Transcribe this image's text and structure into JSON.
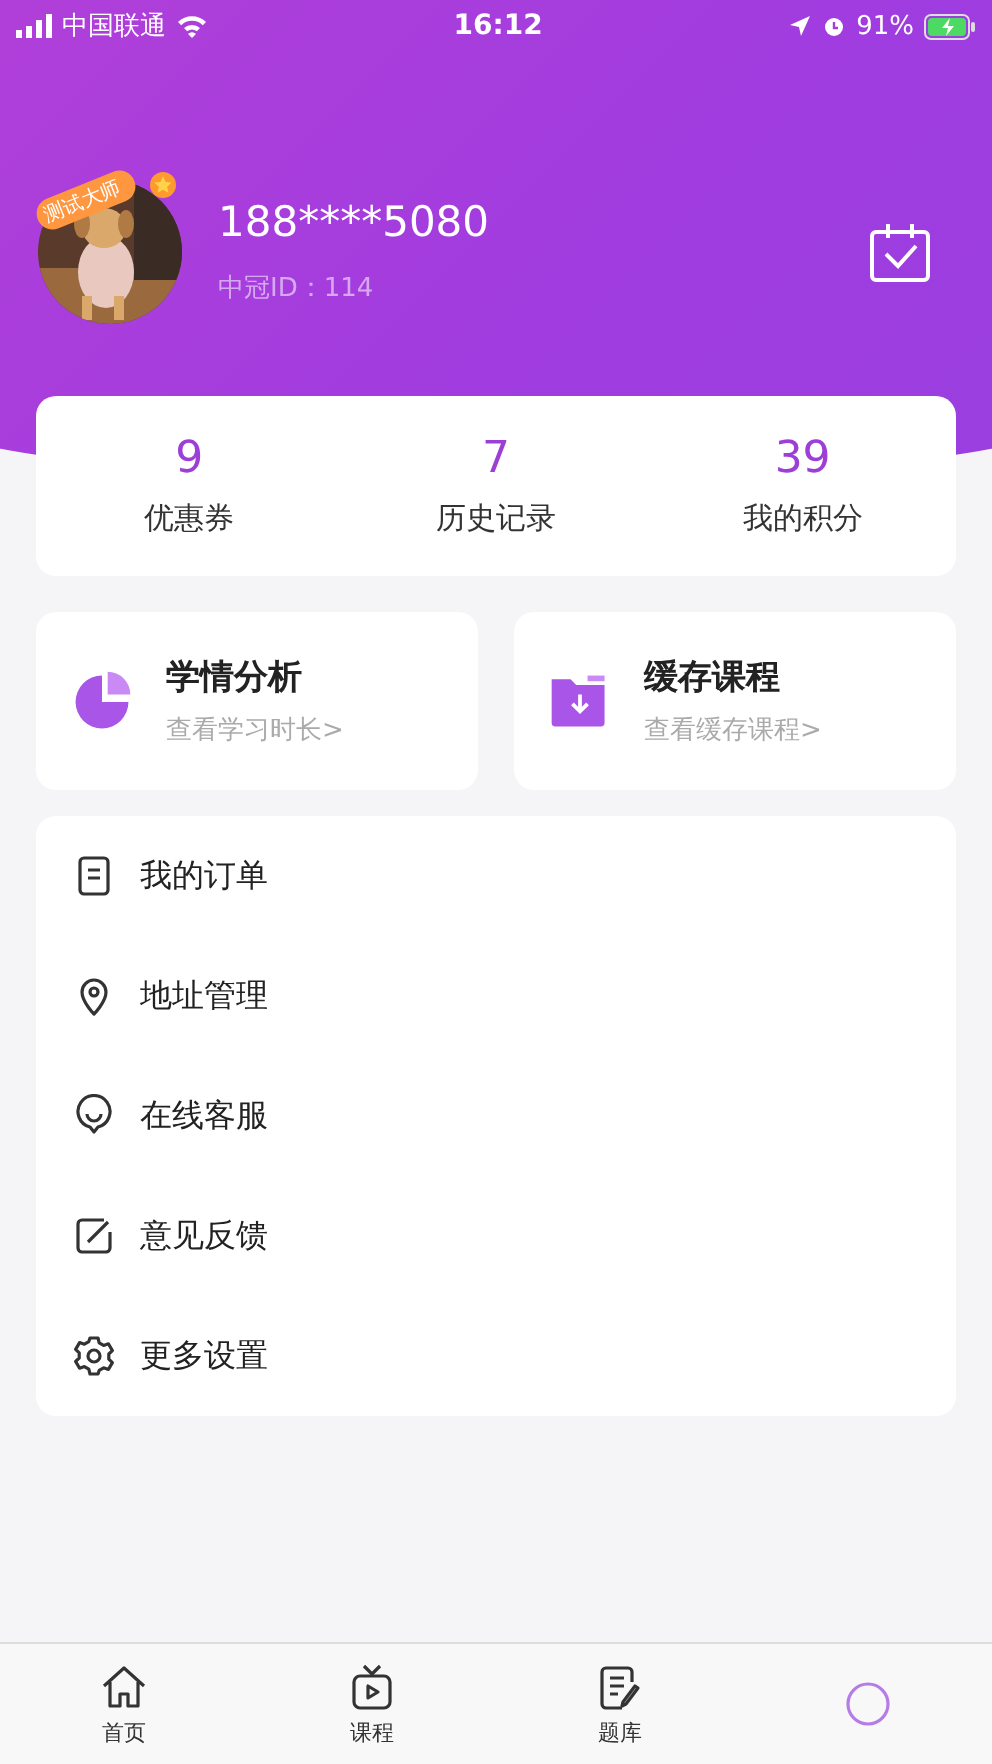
{
  "status_bar": {
    "carrier": "中国联通",
    "time": "16:12",
    "battery": "91%"
  },
  "profile": {
    "badge": "测试大师",
    "phone": "188****5080",
    "id_label": "中冠ID：114"
  },
  "stats": [
    {
      "value": "9",
      "label": "优惠券"
    },
    {
      "value": "7",
      "label": "历史记录"
    },
    {
      "value": "39",
      "label": "我的积分"
    }
  ],
  "shortcuts": [
    {
      "kind": "pie",
      "title": "学情分析",
      "subtitle": "查看学习时长>"
    },
    {
      "kind": "folder",
      "title": "缓存课程",
      "subtitle": "查看缓存课程>"
    }
  ],
  "menu": [
    {
      "kind": "order",
      "label": "我的订单"
    },
    {
      "kind": "pin",
      "label": "地址管理"
    },
    {
      "kind": "chat",
      "label": "在线客服"
    },
    {
      "kind": "edit",
      "label": "意见反馈"
    },
    {
      "kind": "gear",
      "label": "更多设置"
    }
  ],
  "tab_bar": [
    {
      "kind": "home",
      "label": "首页",
      "selected": false
    },
    {
      "kind": "tv",
      "label": "课程",
      "selected": false
    },
    {
      "kind": "note",
      "label": "题库",
      "selected": false
    },
    {
      "kind": "me",
      "selected": true
    }
  ]
}
